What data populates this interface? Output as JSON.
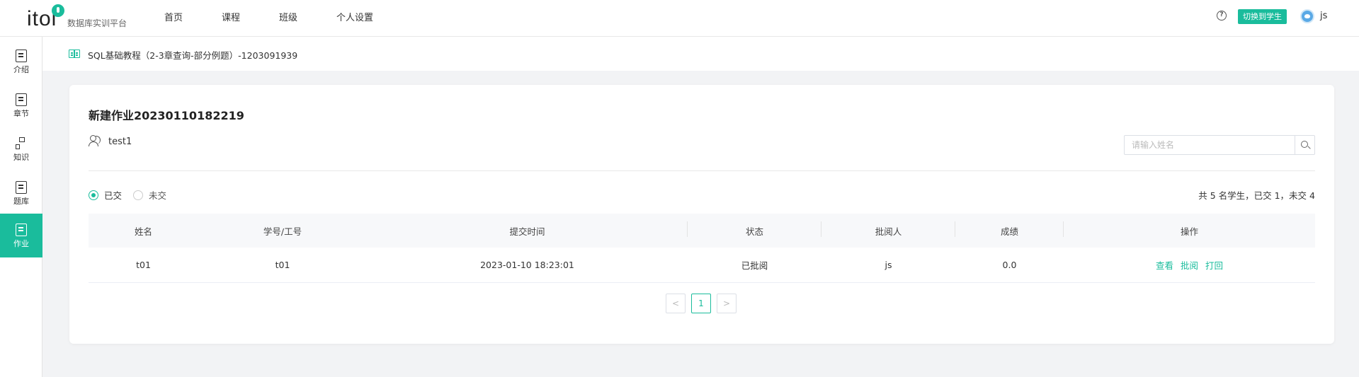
{
  "header": {
    "logo_text": "itol",
    "platform_name": "数据库实训平台",
    "nav": [
      "首页",
      "课程",
      "班级",
      "个人设置"
    ],
    "switch_button": "切换到学生",
    "username": "js"
  },
  "sidebar": {
    "items": [
      {
        "label": "介绍",
        "icon": "document-icon"
      },
      {
        "label": "章节",
        "icon": "chapter-icon"
      },
      {
        "label": "知识",
        "icon": "knowledge-tree-icon"
      },
      {
        "label": "题库",
        "icon": "question-bank-icon"
      },
      {
        "label": "作业",
        "icon": "homework-icon",
        "active": true
      }
    ]
  },
  "breadcrumb": {
    "course": "SQL基础教程（2-3章查询-部分例题）-1203091939"
  },
  "assignment": {
    "title": "新建作业20230110182219",
    "class_name": "test1",
    "search_placeholder": "请输入姓名",
    "filters": [
      {
        "label": "已交",
        "checked": true
      },
      {
        "label": "未交",
        "checked": false
      }
    ],
    "summary": "共 5 名学生，已交 1，未交 4"
  },
  "table": {
    "columns": [
      "姓名",
      "学号/工号",
      "提交时间",
      "状态",
      "批阅人",
      "成绩",
      "操作"
    ],
    "rows": [
      {
        "name": "t01",
        "student_id": "t01",
        "submit_time": "2023-01-10 18:23:01",
        "status": "已批阅",
        "reviewer": "js",
        "score": "0.0",
        "actions": [
          "查看",
          "批阅",
          "打回"
        ]
      }
    ]
  },
  "pagination": {
    "prev": "<",
    "current": "1",
    "next": ">"
  },
  "colors": {
    "accent": "#1abc9c"
  }
}
